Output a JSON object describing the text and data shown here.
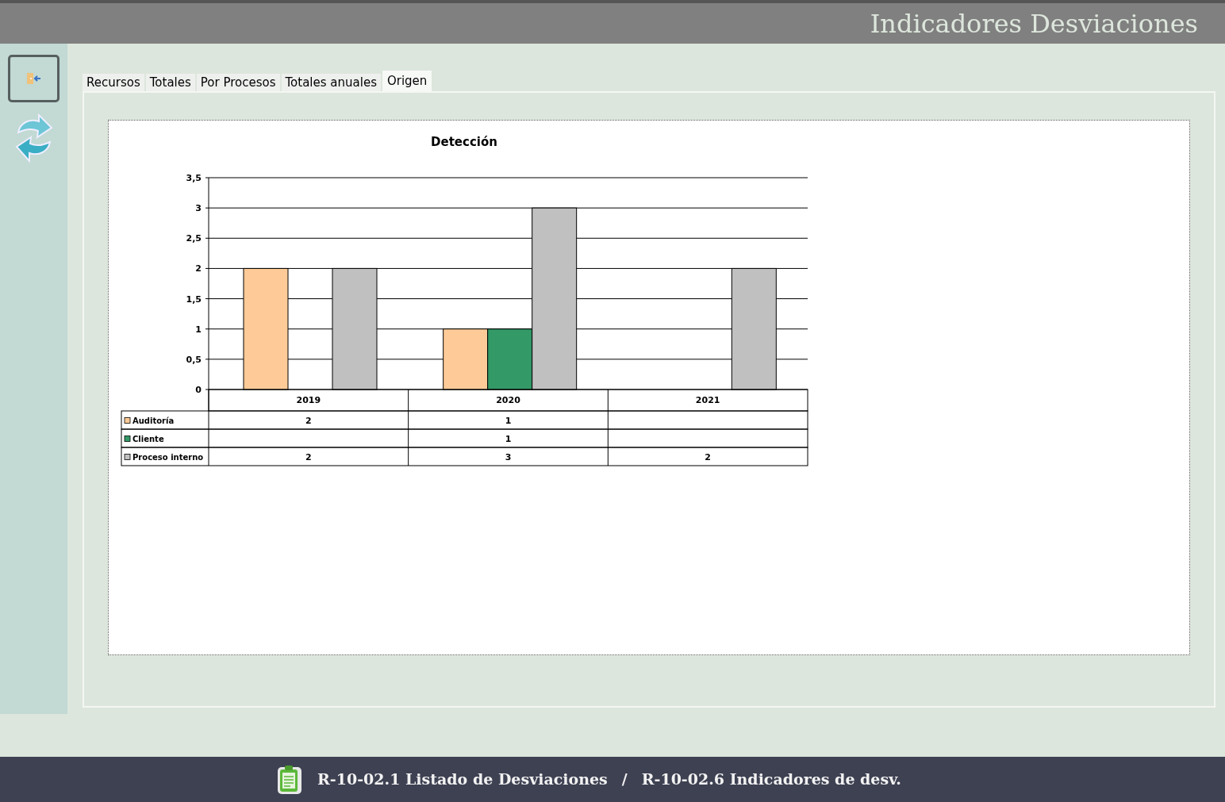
{
  "header": {
    "title": "Indicadores Desviaciones"
  },
  "tabs": [
    {
      "label": "Recursos",
      "selected": false
    },
    {
      "label": "Totales",
      "selected": false
    },
    {
      "label": "Por Procesos",
      "selected": false
    },
    {
      "label": "Totales anuales",
      "selected": false
    },
    {
      "label": "Origen",
      "selected": true
    }
  ],
  "chart": {
    "chart_data": {
      "type": "bar",
      "title": "Detección",
      "categories": [
        "2019",
        "2020",
        "2021"
      ],
      "series": [
        {
          "name": "Auditoría",
          "color": "#fecb98",
          "values": [
            2,
            1,
            null
          ]
        },
        {
          "name": "Cliente",
          "color": "#339966",
          "values": [
            null,
            1,
            null
          ]
        },
        {
          "name": "Proceso interno",
          "color": "#c0c0c0",
          "values": [
            2,
            3,
            2
          ]
        }
      ],
      "ylim": [
        0,
        3.5
      ],
      "grid": true,
      "legend": true,
      "yticks": [
        {
          "value": 0,
          "label": "0"
        },
        {
          "value": 0.5,
          "label": "0,5"
        },
        {
          "value": 1,
          "label": "1"
        },
        {
          "value": 1.5,
          "label": "1,5"
        },
        {
          "value": 2,
          "label": "2"
        },
        {
          "value": 2.5,
          "label": "2,5"
        },
        {
          "value": 3,
          "label": "3"
        },
        {
          "value": 3.5,
          "label": "3,5"
        }
      ]
    },
    "data_table": [
      {
        "2019": "2",
        "2020": "1"
      },
      {
        "2020": "1"
      },
      {
        "2019": "2",
        "2020": "3",
        "2021": "2"
      }
    ]
  },
  "footer": {
    "links": [
      "R-10-02.1 Listado de Desviaciones",
      "R-10-02.6 Indicadores de desv."
    ],
    "separator": "/"
  }
}
